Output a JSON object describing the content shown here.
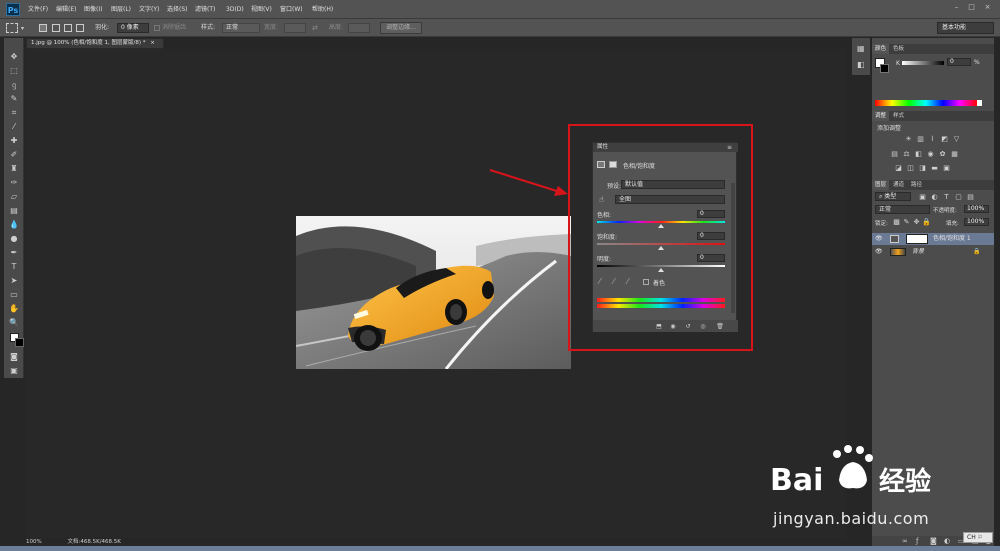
{
  "app": {
    "logo": "Ps"
  },
  "menubar": {
    "items": [
      "文件(F)",
      "编辑(E)",
      "图像(I)",
      "图层(L)",
      "文字(Y)",
      "选择(S)",
      "滤镜(T)",
      "3D(D)",
      "视图(V)",
      "窗口(W)",
      "帮助(H)"
    ],
    "window_buttons": [
      "–",
      "□",
      "×"
    ]
  },
  "options": {
    "feather_label": "羽化:",
    "feather_value": "0 像素",
    "antialias_label": "消除锯齿",
    "style_label": "样式:",
    "style_value": "正常",
    "width_label": "宽度:",
    "height_label": "高度:",
    "refine_edge": "调整边缘...",
    "workspace": "基本功能"
  },
  "document": {
    "tab_title": "1.jpg @ 100% (色相/饱和度 1, 图层蒙版/8) *",
    "tab_close": "×",
    "zoom": "100%",
    "doc_info": "文档:468.5K/468.5K"
  },
  "properties": {
    "title": "属性",
    "adjustment_name": "色相/饱和度",
    "preset_label": "预设:",
    "preset_value": "默认值",
    "channel_value": "全图",
    "hue_label": "色相:",
    "hue_value": "0",
    "saturation_label": "饱和度:",
    "saturation_value": "0",
    "lightness_label": "明度:",
    "lightness_value": "0",
    "colorize_label": "着色"
  },
  "panels": {
    "color_tabs": [
      "颜色",
      "色板"
    ],
    "color_channel_label": "K",
    "color_value": "0",
    "color_unit": "%",
    "adjust_tabs": [
      "调整",
      "样式"
    ],
    "add_adjustment": "添加调整",
    "layer_tabs": [
      "图层",
      "通道",
      "路径"
    ],
    "kind_label": "类型",
    "blend_mode": "正常",
    "opacity_label": "不透明度:",
    "opacity_value": "100%",
    "lock_label": "锁定:",
    "fill_label": "填充:",
    "fill_value": "100%",
    "layers": [
      {
        "name": "色相/饱和度 1"
      },
      {
        "name": "背景"
      }
    ]
  },
  "watermark": {
    "brand": "Bai",
    "brand_suffix": "经验",
    "url": "jingyan.baidu.com"
  },
  "ime": "CH",
  "colors": {
    "highlight": "#d8141b",
    "arrow": "#d8141b",
    "car": "#f2a31c"
  }
}
